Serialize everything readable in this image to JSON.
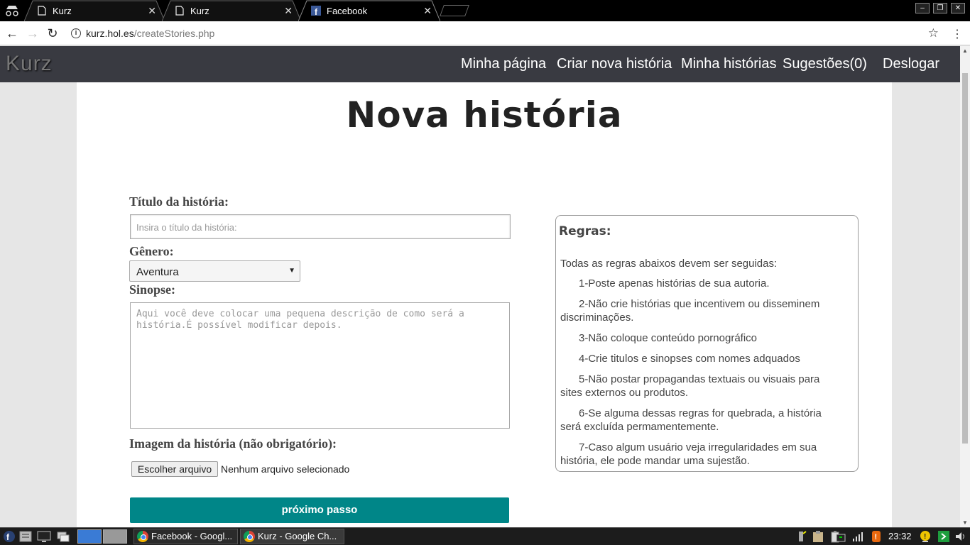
{
  "browser": {
    "tabs": [
      {
        "title": "Kurz",
        "icon": "page-icon",
        "active": false
      },
      {
        "title": "Kurz",
        "icon": "page-icon",
        "active": false
      },
      {
        "title": "Facebook",
        "icon": "facebook-icon",
        "active": true
      }
    ],
    "url_host": "kurz.hol.es",
    "url_path": "/createStories.php"
  },
  "site": {
    "logo": "Kurz",
    "nav": [
      "Minha página",
      "Criar nova história",
      "Minha histórias",
      "Sugestões(0)",
      "Deslogar"
    ]
  },
  "page": {
    "heading": "Nova história",
    "form": {
      "title_label": "Título da história:",
      "title_placeholder": "Insira o título da história:",
      "genre_label": "Gênero:",
      "genre_value": "Aventura",
      "synopsis_label": "Sinopse:",
      "synopsis_placeholder": "Aqui você deve colocar uma pequena descrição de como será a história.É possível modificar depois.",
      "image_label": "Imagem da história (não obrigatório):",
      "file_button": "Escolher arquivo",
      "file_status": "Nenhum arquivo selecionado",
      "next_button": "próximo passo"
    },
    "rules": {
      "title": "Regras:",
      "intro": "Todas as regras abaixos devem ser seguidas:",
      "items": [
        "1-Poste apenas histórias de sua autoria.",
        "2-Não crie histórias que incentivem ou disseminem discriminações.",
        "3-Não coloque conteúdo pornográfico",
        "4-Crie titulos e sinopses com nomes adquados",
        "5-Não postar propagandas textuais ou visuais para sites externos ou produtos.",
        "6-Se alguma dessas regras for quebrada, a história será excluída permamentemente.",
        "7-Caso algum usuário veja irregularidades em sua história, ele pode mandar uma sujestão."
      ]
    }
  },
  "taskbar": {
    "tasks": [
      "Facebook - Googl...",
      "Kurz - Google Ch..."
    ],
    "clock": "23:32"
  },
  "colors": {
    "nav_bg": "#393a41",
    "accent_button": "#008688"
  }
}
